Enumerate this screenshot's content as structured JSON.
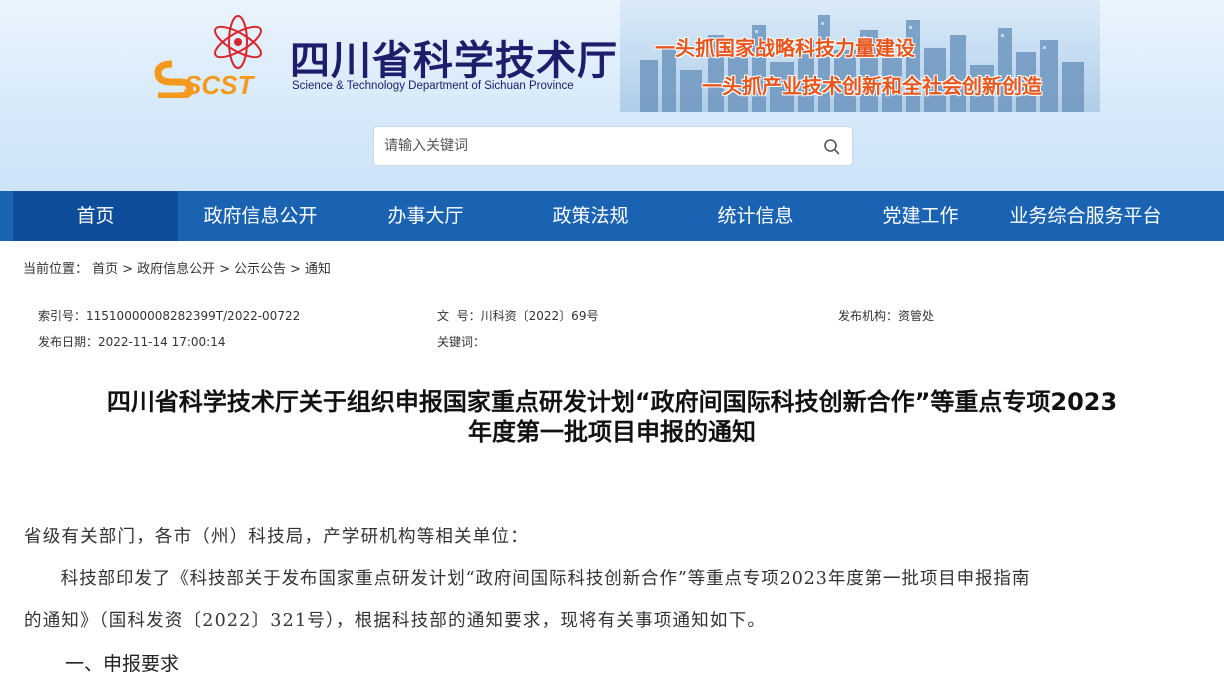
{
  "header": {
    "logo_text": "SCST",
    "site_title": "四川省科学技术厅",
    "site_subtitle": "Science & Technology Department of Sichuan Province",
    "slogan_1": "一头抓国家战略科技力量建设",
    "slogan_2": "一头抓产业技术创新和全社会创新创造"
  },
  "search": {
    "placeholder": "请输入关键词",
    "icon": "search-icon"
  },
  "nav": {
    "items": [
      "首页",
      "政府信息公开",
      "办事大厅",
      "政策法规",
      "统计信息",
      "党建工作",
      "业务综合服务平台"
    ],
    "active_index": 0
  },
  "breadcrumb": {
    "label": "当前位置：",
    "items": [
      "首页",
      "政府信息公开",
      "公示公告",
      "通知"
    ],
    "separator": ">"
  },
  "meta": {
    "index_label": "索引号：",
    "index_value": "11510000008282399T/2022-00722",
    "doc_label": "文  号：",
    "doc_value": "川科资〔2022〕69号",
    "org_label": "发布机构：",
    "org_value": "资管处",
    "date_label": "发布日期：",
    "date_value": "2022-11-14 17:00:14",
    "keyword_label": "关键词：",
    "keyword_value": ""
  },
  "article": {
    "title_line1": "四川省科学技术厅关于组织申报国家重点研发计划“政府间国际科技创新合作”等重点专项2023",
    "title_line2": "年度第一批项目申报的通知",
    "salutation": "省级有关部门，各市（州）科技局，产学研机构等相关单位：",
    "para1_line1": "　　科技部印发了《科技部关于发布国家重点研发计划“政府间国际科技创新合作”等重点专项2023年度第一批项目申报指南",
    "para1_line2": "的通知》（国科发资〔2022〕321号），根据科技部的通知要求，现将有关事项通知如下。",
    "section1": "一、申报要求"
  },
  "colors": {
    "nav_bg": "#1a63b3",
    "nav_active": "#0d4d9a",
    "title_color": "#1d1d6b",
    "slogan_color": "#e8561e"
  }
}
